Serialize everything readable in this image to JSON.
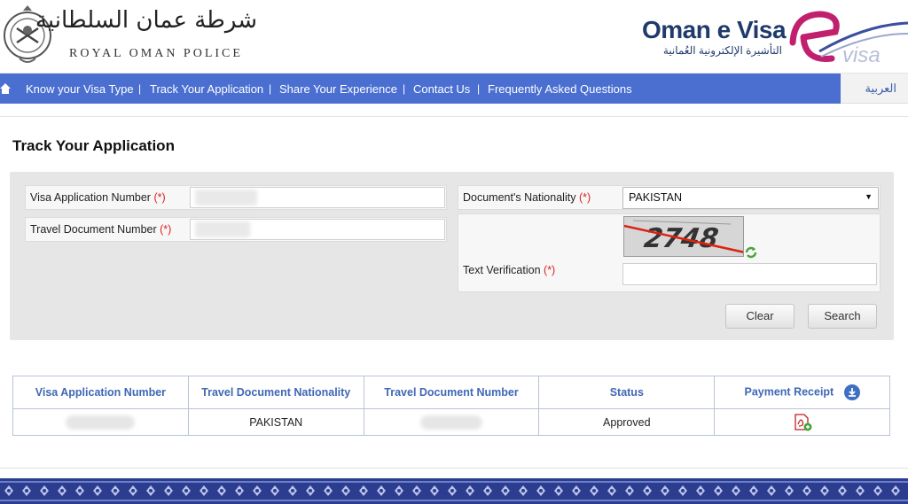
{
  "header": {
    "police_arabic": "شرطة عمان السلطانية",
    "police_english": "ROYAL OMAN POLICE",
    "evisa_brand": "Oman e Visa",
    "evisa_arabic": "التأشيرة الإلكترونية العُمانية",
    "logo_letter": "e",
    "logo_word": "visa"
  },
  "nav": {
    "items": [
      "Know your Visa Type",
      "Track Your Application",
      "Share Your Experience",
      "Contact Us",
      "Frequently Asked Questions"
    ],
    "separator": "|",
    "language_link": "العربية"
  },
  "page_title": "Track Your Application",
  "form": {
    "visa_application_number_label": "Visa Application Number",
    "travel_document_number_label": "Travel Document Number",
    "nationality_label": "Document's Nationality",
    "nationality_value": "PAKISTAN",
    "required_marker": "(*)",
    "captcha_text": "2748",
    "text_verification_label": "Text Verification",
    "clear_button": "Clear",
    "search_button": "Search"
  },
  "results_table": {
    "columns": [
      "Visa Application Number",
      "Travel Document Nationality",
      "Travel Document Number",
      "Status",
      "Payment Receipt"
    ],
    "rows": [
      {
        "nationality": "PAKISTAN",
        "status": "Approved"
      }
    ]
  },
  "colors": {
    "nav_bar": "#4a6fd1",
    "table_header_text": "#3f68b5",
    "brand_navy": "#1f3a6b",
    "brand_magenta": "#c0206e",
    "required_red": "#dd2222",
    "footer_band": "#2c3d8f"
  }
}
